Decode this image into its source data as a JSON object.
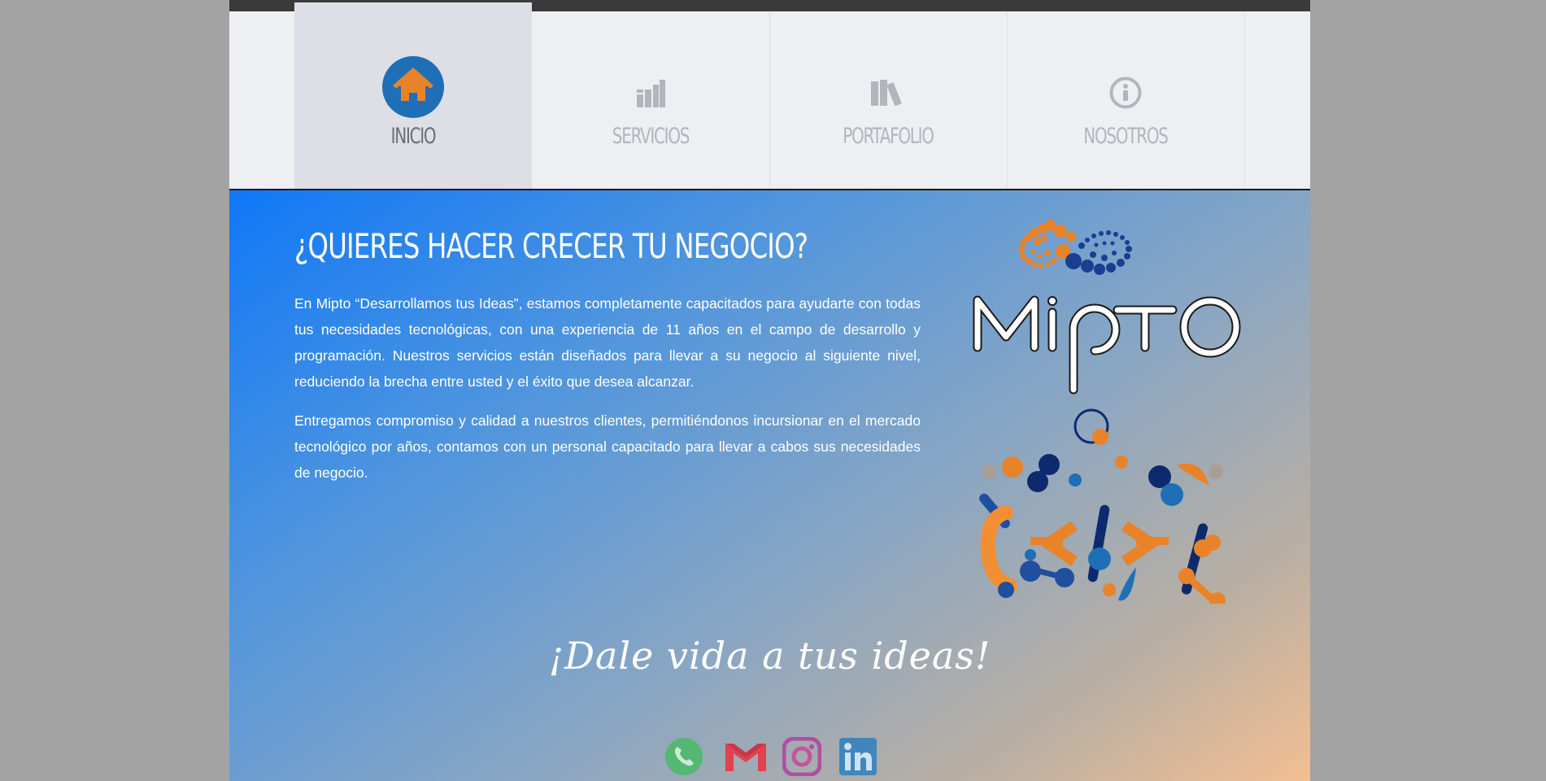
{
  "nav": {
    "items": [
      {
        "label": "INICIO",
        "icon": "home-icon",
        "active": true
      },
      {
        "label": "SERVICIOS",
        "icon": "bar-chart-icon",
        "active": false
      },
      {
        "label": "PORTAFOLIO",
        "icon": "books-icon",
        "active": false
      },
      {
        "label": "NOSOTROS",
        "icon": "info-icon",
        "active": false
      }
    ]
  },
  "hero": {
    "title": "¿QUIERES HACER CRECER TU NEGOCIO?",
    "paragraph1": "En Mipto “Desarrollamos tus Ideas”, estamos completamente capacitados para ayudarte con todas tus necesidades tecnológicas, con una experiencia de 11 años en el campo de desarrollo y programación. Nuestros servicios están diseñados para llevar a su negocio al siguiente nivel, reduciendo la brecha entre usted y el éxito que desea alcanzar.",
    "paragraph2": "Entregamos compromiso y calidad a nuestros clientes, permitiéndonos incursionar en el mercado tecnológico por años, contamos con un personal capacitado para llevar a cabos sus necesidades de negocio.",
    "logo_text": "Mipto",
    "slogan": "¡Dale vida a tus ideas!"
  },
  "social": [
    {
      "icon": "whatsapp-icon",
      "color": "#4cb86b"
    },
    {
      "icon": "gmail-icon",
      "color": "#e0424f"
    },
    {
      "icon": "instagram-icon",
      "color": "#b14fa0"
    },
    {
      "icon": "linkedin-icon",
      "color": "#2e7fc1"
    }
  ],
  "colors": {
    "accent_orange": "#e8832a",
    "accent_blue": "#1f6fb6",
    "navy": "#0e2a6e"
  }
}
